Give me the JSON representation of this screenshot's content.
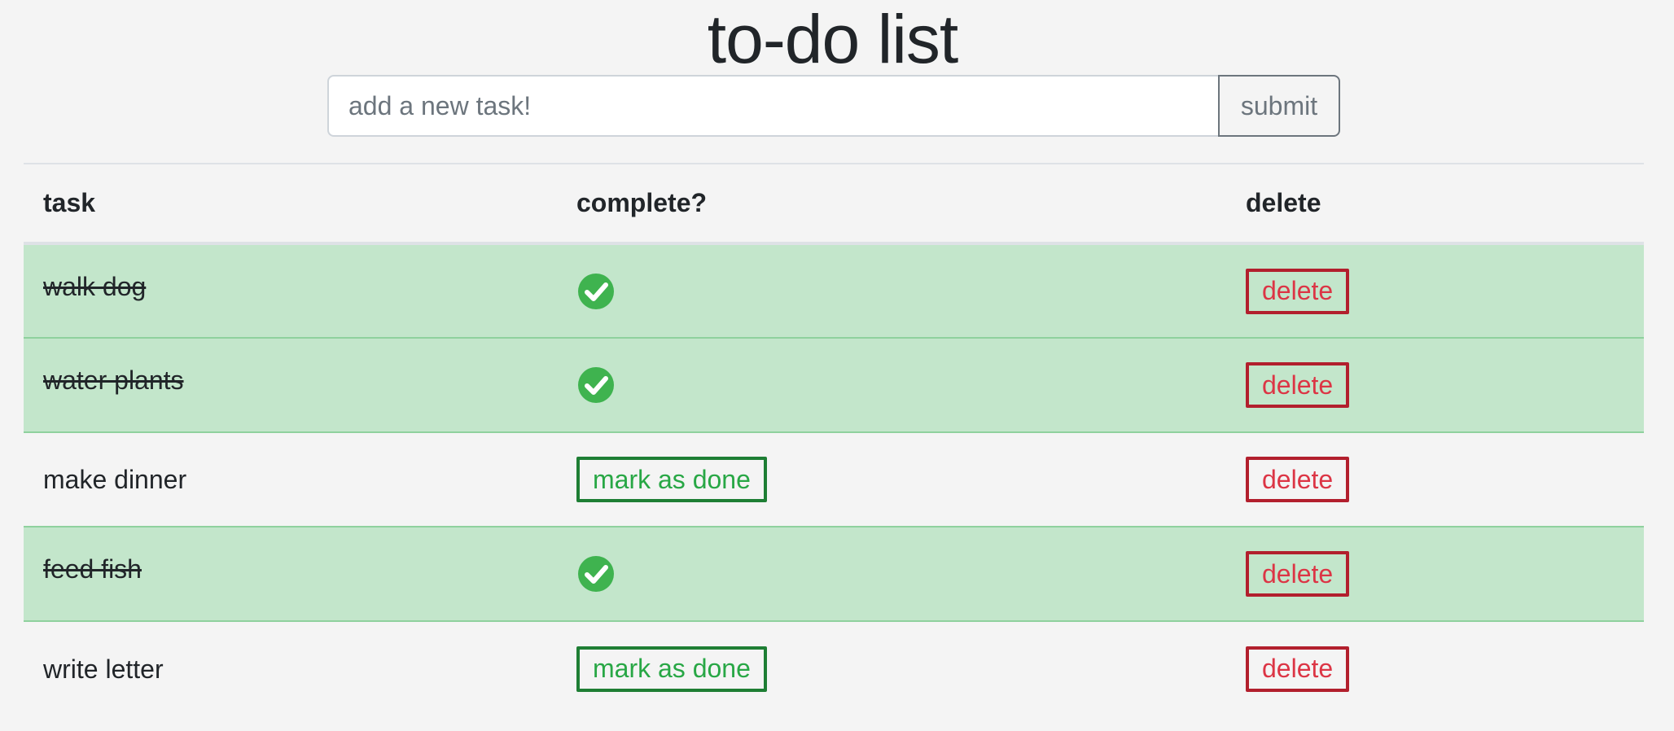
{
  "header": {
    "title": "to-do list"
  },
  "form": {
    "placeholder": "add a new task!",
    "value": "",
    "submit_label": "submit"
  },
  "table": {
    "columns": [
      "task",
      "complete?",
      "delete"
    ],
    "rows": [
      {
        "task": "walk dog",
        "complete": true,
        "complete_icon": "check-circle-icon",
        "delete_label": "delete"
      },
      {
        "task": "water plants",
        "complete": true,
        "complete_icon": "check-circle-icon",
        "delete_label": "delete"
      },
      {
        "task": "make dinner",
        "complete": false,
        "mark_label": "mark as done",
        "delete_label": "delete"
      },
      {
        "task": "feed fish",
        "complete": true,
        "complete_icon": "check-circle-icon",
        "delete_label": "delete"
      },
      {
        "task": "write letter",
        "complete": false,
        "mark_label": "mark as done",
        "delete_label": "delete"
      }
    ]
  },
  "colors": {
    "page_background": "#f4f4f4",
    "done_row_background": "#c3e6cb",
    "check_icon": "#3fb34f",
    "mark_button": "#28a745",
    "delete_button": "#dc3545"
  }
}
